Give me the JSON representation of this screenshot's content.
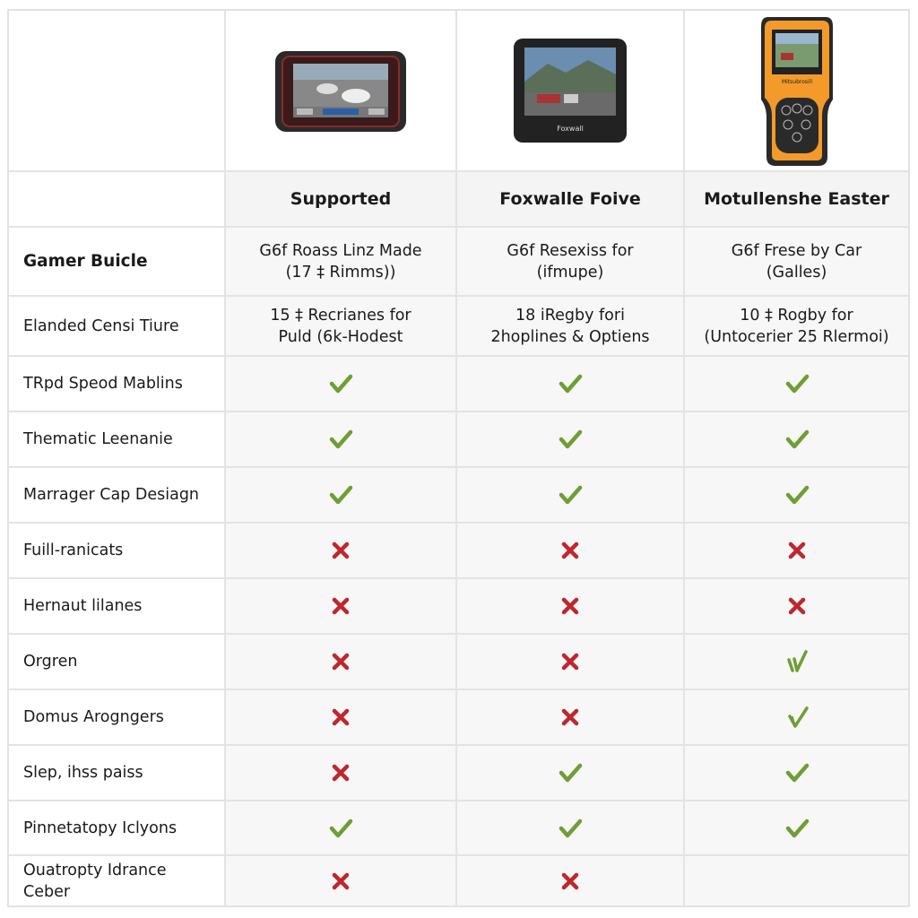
{
  "products": [
    {
      "name": "Supported",
      "image": "tablet-scanner-icon",
      "screen_label": ""
    },
    {
      "name": "Foxwalle Foive",
      "image": "handheld-screen-device-icon",
      "screen_label": "Foxwall"
    },
    {
      "name": "Motullenshe Easter",
      "image": "orange-handheld-scanner-icon",
      "screen_label": "Mitsubrosill"
    }
  ],
  "rows": [
    {
      "label": "Gamer Buicle",
      "bold": true,
      "type": "text",
      "values": [
        [
          "G6f Roass Linz Made",
          "(17 ‡ Rimms))"
        ],
        [
          "G6f Resexiss for",
          "(ifmupe)"
        ],
        [
          "G6f Frese by Car",
          "(Galles)"
        ]
      ]
    },
    {
      "label": "Elanded Censi Tiure",
      "type": "text",
      "values": [
        [
          "15 ‡ Recrianes for",
          "Puld (6k-Hodest"
        ],
        [
          "18 iRegby fori",
          "2hoplines & Optiens"
        ],
        [
          "10 ‡ Rogby for",
          "(Untocerier 25 Rlermoi)"
        ]
      ]
    },
    {
      "label": "TRpd Speod Mablins",
      "type": "mark",
      "values": [
        "check",
        "check",
        "check"
      ]
    },
    {
      "label": "Thematic Leenanie",
      "type": "mark",
      "values": [
        "check",
        "check",
        "check"
      ]
    },
    {
      "label": "Marrager Cap Desiagn",
      "type": "mark",
      "values": [
        "check",
        "check",
        "check"
      ]
    },
    {
      "label": "Fuill-ranicats",
      "type": "mark",
      "values": [
        "cross",
        "cross",
        "cross"
      ]
    },
    {
      "label": "Hernaut lilanes",
      "type": "mark",
      "values": [
        "cross",
        "cross",
        "cross"
      ]
    },
    {
      "label": "Orgren",
      "type": "mark",
      "values": [
        "cross",
        "cross",
        "check-double"
      ]
    },
    {
      "label": "Domus Arogngers",
      "type": "mark",
      "values": [
        "cross",
        "cross",
        "check-sketch"
      ]
    },
    {
      "label": "Slep, ihss paiss",
      "type": "mark",
      "values": [
        "cross",
        "check",
        "check"
      ]
    },
    {
      "label": "Pinnetatopy Iclyons",
      "type": "mark",
      "values": [
        "check",
        "check",
        "check"
      ]
    },
    {
      "label": "Ouatropty Idrance Ceber",
      "type": "mark",
      "values": [
        "cross",
        "cross",
        "none"
      ]
    }
  ],
  "colors": {
    "check": "#6f9e34",
    "cross": "#c0262d",
    "border": "#e3e3e3",
    "cell_bg": "#f7f7f7",
    "device_orange": "#f39a2a"
  }
}
